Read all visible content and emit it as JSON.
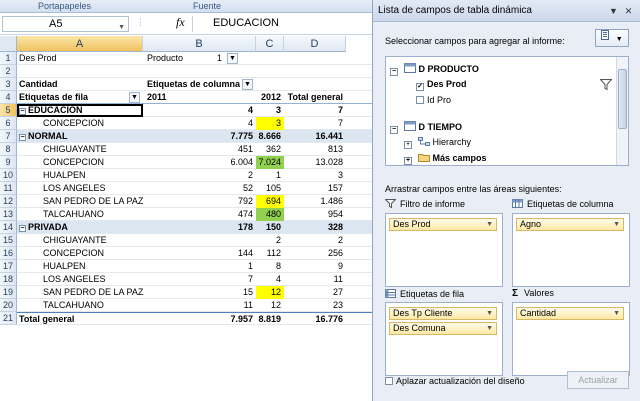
{
  "ribbon": {
    "groups": [
      "Portapapeles",
      "Fuente"
    ]
  },
  "formula": {
    "namebox": "A5",
    "fx": "fx",
    "value": "EDUCACION"
  },
  "columns": [
    "A",
    "B",
    "C",
    "D"
  ],
  "rows_nums": [
    "1",
    "2",
    "3",
    "4",
    "5",
    "6",
    "7",
    "8",
    "9",
    "10",
    "11",
    "12",
    "13",
    "14",
    "15",
    "16",
    "17",
    "18",
    "19",
    "20",
    "21"
  ],
  "sheet": {
    "r1": {
      "a": "Des Prod",
      "b": "Producto",
      "c": "1"
    },
    "r3": {
      "a": "Cantidad",
      "b": "Etiquetas de columna"
    },
    "r4": {
      "a": "Etiquetas de fila",
      "b": "2011",
      "c": "2012",
      "d": "Total general"
    },
    "data": [
      {
        "a": "EDUCACION",
        "b": "4",
        "c": "3",
        "d": "7"
      },
      {
        "a": "CONCEPCION",
        "b": "4",
        "c": "3",
        "d": "7"
      },
      {
        "a": "NORMAL",
        "b": "7.775",
        "c": "8.666",
        "d": "16.441"
      },
      {
        "a": "CHIGUAYANTE",
        "b": "451",
        "c": "362",
        "d": "813"
      },
      {
        "a": "CONCEPCION",
        "b": "6.004",
        "c": "7.024",
        "d": "13.028"
      },
      {
        "a": "HUALPEN",
        "b": "2",
        "c": "1",
        "d": "3"
      },
      {
        "a": "LOS ANGELES",
        "b": "52",
        "c": "105",
        "d": "157"
      },
      {
        "a": "SAN PEDRO DE LA PAZ",
        "b": "792",
        "c": "694",
        "d": "1.486"
      },
      {
        "a": "TALCAHUANO",
        "b": "474",
        "c": "480",
        "d": "954"
      },
      {
        "a": "PRIVADA",
        "b": "178",
        "c": "150",
        "d": "328"
      },
      {
        "a": "CHIGUAYANTE",
        "b": "",
        "c": "2",
        "d": "2"
      },
      {
        "a": "CONCEPCION",
        "b": "144",
        "c": "112",
        "d": "256"
      },
      {
        "a": "HUALPEN",
        "b": "1",
        "c": "8",
        "d": "9"
      },
      {
        "a": "LOS ANGELES",
        "b": "7",
        "c": "4",
        "d": "11"
      },
      {
        "a": "SAN PEDRO DE LA PAZ",
        "b": "15",
        "c": "12",
        "d": "27"
      },
      {
        "a": "TALCAHUANO",
        "b": "11",
        "c": "12",
        "d": "23"
      },
      {
        "a": "Total general",
        "b": "7.957",
        "c": "8.819",
        "d": "16.776"
      }
    ]
  },
  "panel": {
    "title": "Lista de campos de tabla dinámica",
    "choose_label": "Seleccionar campos para agregar al informe:",
    "fields": {
      "d_producto": "D PRODUCTO",
      "des_prod": "Des Prod",
      "id_pro": "Id Pro",
      "d_tiempo": "D TIEMPO",
      "hierarchy": "Hierarchy",
      "mas_campos": "Más campos"
    },
    "drag_label": "Arrastrar campos entre las áreas siguientes:",
    "areas": {
      "filter_title": "Filtro de informe",
      "columns_title": "Etiquetas de columna",
      "rows_title": "Etiquetas de fila",
      "values_title": "Valores",
      "values_sigma": "Σ"
    },
    "chips": {
      "filter": "Des Prod",
      "columns": "Agno",
      "rows1": "Des Tp Cliente",
      "rows2": "Des Comuna",
      "values": "Cantidad"
    },
    "defer_label": "Aplazar actualización del diseño",
    "update_label": "Actualizar"
  },
  "colors": {
    "highlight_yellow": "#ffff00",
    "highlight_green": "#92d050",
    "band": "#dce6f1"
  }
}
